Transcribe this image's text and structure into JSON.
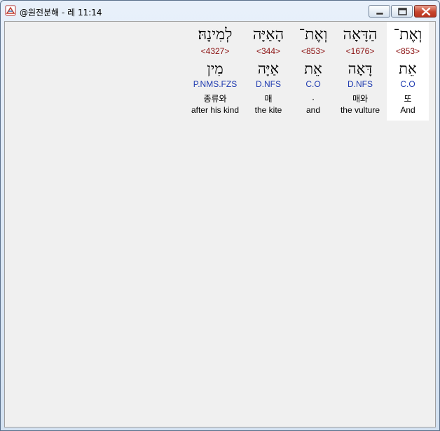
{
  "window": {
    "title": "@원전분해 - 레 11:14",
    "controls": {
      "minimize": "minimize",
      "maximize": "maximize",
      "close": "close"
    }
  },
  "words": [
    {
      "hebrew": "וְאֶת־",
      "strong": "<853>",
      "lexeme": "אֵת",
      "morph": "C.O",
      "korean": "또",
      "english": "And",
      "highlighted": true
    },
    {
      "hebrew": "הַדָּאָה",
      "strong": "<1676>",
      "lexeme": "דָּאָה",
      "morph": "D.NFS",
      "korean": "매와",
      "english": "the vulture",
      "highlighted": false
    },
    {
      "hebrew": "וְאֶת־",
      "strong": "<853>",
      "lexeme": "אֵת",
      "morph": "C.O",
      "korean": ".",
      "english": "and",
      "highlighted": false
    },
    {
      "hebrew": "הָאַיָּה",
      "strong": "<344>",
      "lexeme": "אַיָּה",
      "morph": "D.NFS",
      "korean": "매",
      "english": "the kite",
      "highlighted": false
    },
    {
      "hebrew": "לְמִינָהּ׃",
      "strong": "<4327>",
      "lexeme": "מִין",
      "morph": "P.NMS.FZS",
      "korean": "종류와",
      "english": "after his kind",
      "highlighted": false
    }
  ],
  "colors": {
    "strong": "#8b1010",
    "morph": "#1f3bb0",
    "highlight_bg": "#ffffff",
    "client_bg": "#f0f0f0"
  }
}
